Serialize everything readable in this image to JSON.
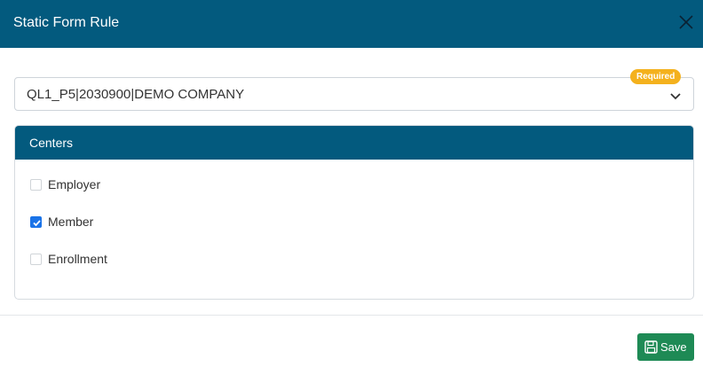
{
  "modal": {
    "title": "Static Form Rule",
    "close_icon": "close-icon"
  },
  "select": {
    "value": "QL1_P5|2030900|DEMO COMPANY",
    "required_badge": "Required",
    "icon": "chevron-down-icon"
  },
  "centers": {
    "title": "Centers",
    "items": [
      {
        "label": "Employer",
        "checked": false
      },
      {
        "label": "Member",
        "checked": true
      },
      {
        "label": "Enrollment",
        "checked": false
      }
    ]
  },
  "footer": {
    "save_label": "Save",
    "save_icon": "floppy-disk-icon"
  },
  "colors": {
    "header": "#035a7e",
    "required_badge": "#f4b11d",
    "checkbox_checked": "#1a73e8",
    "save_button": "#1e8a55"
  }
}
